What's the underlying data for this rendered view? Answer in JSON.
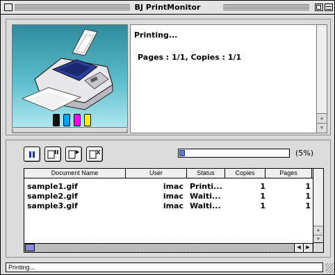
{
  "window": {
    "title": "BJ PrintMonitor"
  },
  "printer": {
    "icon": "printer-icon",
    "inks": [
      {
        "name": "black",
        "color": "#111111"
      },
      {
        "name": "cyan",
        "color": "#00a2ff"
      },
      {
        "name": "magenta",
        "color": "#ff00ff"
      },
      {
        "name": "yellow",
        "color": "#ffee00"
      }
    ]
  },
  "status": {
    "line1": "Printing...",
    "line2": "Pages : 1/1, Copies : 1/1"
  },
  "toolbar": {
    "buttons": [
      {
        "name": "pause-button",
        "icon": "pause-icon"
      },
      {
        "name": "hold-button",
        "icon": "document-pause-icon"
      },
      {
        "name": "resume-button",
        "icon": "document-play-icon"
      },
      {
        "name": "delete-button",
        "icon": "document-delete-icon"
      }
    ]
  },
  "progress": {
    "value": 0.05,
    "label": "(5%)"
  },
  "table": {
    "headers": [
      "Document Name",
      "User",
      "Status",
      "Copies",
      "Pages"
    ],
    "rows": [
      {
        "doc": "sample1.gif",
        "user": "imac",
        "status": "Printi...",
        "copies": "1",
        "pages": "1"
      },
      {
        "doc": "sample2.gif",
        "user": "imac",
        "status": "Waiti...",
        "copies": "1",
        "pages": "1"
      },
      {
        "doc": "sample3.gif",
        "user": "imac",
        "status": "Waiti...",
        "copies": "1",
        "pages": "1"
      }
    ]
  },
  "statusbar": {
    "text": "Printing..."
  },
  "colors": {
    "progress_fill": "#5a7fd6",
    "scroll_thumb": "#8a8ad6"
  }
}
